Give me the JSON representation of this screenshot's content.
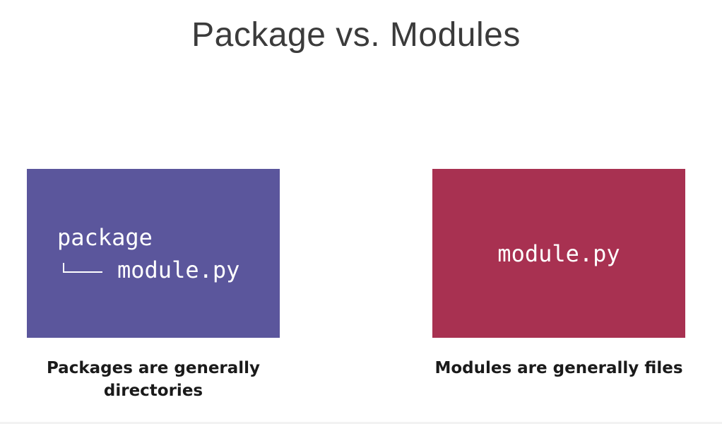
{
  "slide": {
    "title": "Package vs. Modules"
  },
  "left_card": {
    "package_name": "package",
    "module_name": "module.py",
    "caption": "Packages are generally directories",
    "color": "#5b569c"
  },
  "right_card": {
    "module_name": "module.py",
    "caption": "Modules are generally files",
    "color": "#a83151"
  }
}
